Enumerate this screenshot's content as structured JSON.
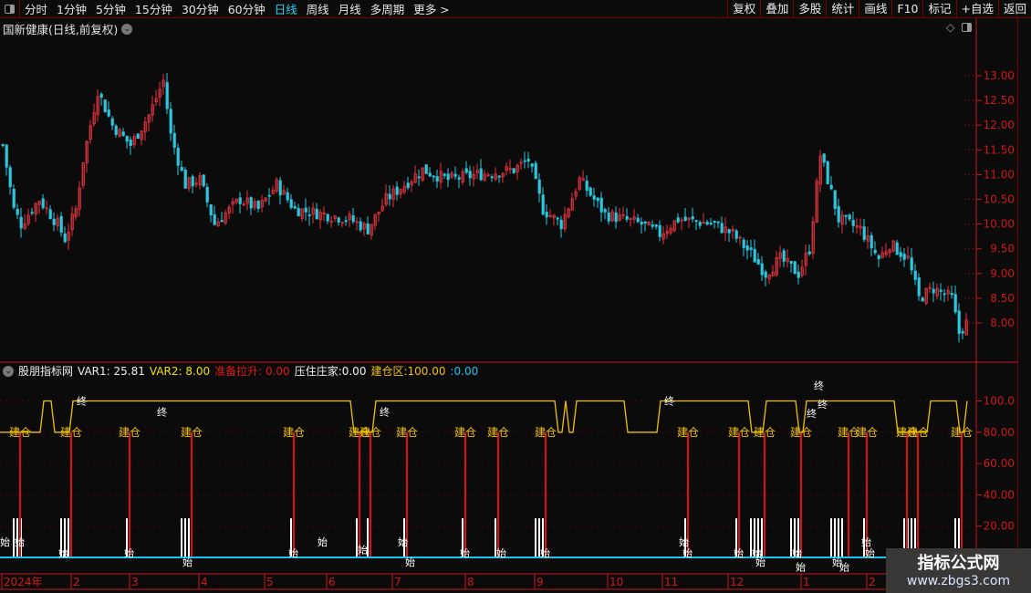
{
  "toolbar": {
    "periods": [
      "分时",
      "1分钟",
      "5分钟",
      "15分钟",
      "30分钟",
      "60分钟",
      "日线",
      "周线",
      "月线",
      "多周期",
      "更多 >"
    ],
    "active_period": "日线",
    "right_buttons": [
      "复权",
      "叠加",
      "多股",
      "统计",
      "画线",
      "F10",
      "标记",
      "+自选",
      "返回"
    ]
  },
  "main_chart": {
    "title": "国新健康(日线,前复权)",
    "y_ticks": [
      "13.00",
      "12.50",
      "12.00",
      "11.50",
      "11.00",
      "10.50",
      "10.00",
      "9.50",
      "9.00",
      "8.50",
      "8.00"
    ]
  },
  "indicator": {
    "name": "股朋指标网",
    "var1_label": "VAR1:",
    "var1": "25.81",
    "var2_label": "VAR2:",
    "var2": "8.00",
    "zbls_label": "准备拉升:",
    "zbls": "0.00",
    "yzzj_label": "压住庄家:",
    "yzzj": "0.00",
    "jcq_label": "建仓区:",
    "jcq": "100.00",
    "extra_label": ":",
    "extra": "0.00",
    "y_ticks": [
      "100.0",
      "80.00",
      "60.00",
      "40.00",
      "20.00"
    ],
    "label_build": "建仓",
    "label_end": "终",
    "label_start": "始"
  },
  "x_axis": {
    "labels": [
      "2024年",
      "2",
      "3",
      "4",
      "5",
      "6",
      "7",
      "8",
      "9",
      "10",
      "11",
      "12",
      "1",
      "2"
    ]
  },
  "watermark": {
    "line1": "指标公式网",
    "line2": "www.zbgs3.com"
  },
  "colors": {
    "up": "#e8323c",
    "down": "#29c8e0",
    "axis": "#c8141e",
    "yellow": "#f0c000",
    "cyan": "#19c6f0"
  },
  "chart_data": {
    "type": "candlestick",
    "y_range": [
      7.6,
      13.8
    ],
    "price_keypoints": [
      [
        0,
        11.6
      ],
      [
        3,
        10.3
      ],
      [
        5,
        10.0
      ],
      [
        10,
        10.5
      ],
      [
        15,
        10.0
      ],
      [
        17,
        9.7
      ],
      [
        20,
        10.3
      ],
      [
        22,
        11.3
      ],
      [
        26,
        12.7
      ],
      [
        30,
        12.0
      ],
      [
        35,
        11.6
      ],
      [
        40,
        12.2
      ],
      [
        44,
        12.9
      ],
      [
        46,
        11.8
      ],
      [
        50,
        10.8
      ],
      [
        54,
        10.9
      ],
      [
        58,
        10.0
      ],
      [
        65,
        10.5
      ],
      [
        70,
        10.3
      ],
      [
        75,
        10.8
      ],
      [
        80,
        10.3
      ],
      [
        88,
        10.2
      ],
      [
        95,
        10.1
      ],
      [
        100,
        9.9
      ],
      [
        105,
        10.5
      ],
      [
        115,
        11.1
      ],
      [
        122,
        10.9
      ],
      [
        130,
        11.0
      ],
      [
        140,
        11.1
      ],
      [
        144,
        11.3
      ],
      [
        148,
        10.3
      ],
      [
        153,
        10.0
      ],
      [
        158,
        10.9
      ],
      [
        165,
        10.2
      ],
      [
        175,
        10.0
      ],
      [
        180,
        9.8
      ],
      [
        185,
        10.1
      ],
      [
        195,
        10.0
      ],
      [
        200,
        9.8
      ],
      [
        205,
        9.4
      ],
      [
        209,
        9.0
      ],
      [
        213,
        9.3
      ],
      [
        218,
        9.0
      ],
      [
        221,
        9.5
      ],
      [
        224,
        11.4
      ],
      [
        226,
        10.9
      ],
      [
        229,
        10.1
      ],
      [
        235,
        9.9
      ],
      [
        240,
        9.3
      ],
      [
        243,
        9.6
      ],
      [
        248,
        9.3
      ],
      [
        251,
        8.5
      ],
      [
        255,
        8.7
      ],
      [
        260,
        8.5
      ],
      [
        262,
        7.8
      ],
      [
        264,
        8.0
      ]
    ],
    "indicator_series": {
      "jianc_segments": [
        [
          0,
          80
        ],
        [
          11,
          100
        ],
        [
          14,
          80
        ],
        [
          19,
          100
        ],
        [
          96,
          80
        ],
        [
          102,
          100
        ],
        [
          152,
          80
        ],
        [
          154,
          100
        ],
        [
          155,
          80
        ],
        [
          157,
          100
        ],
        [
          171,
          80
        ],
        [
          180,
          100
        ],
        [
          205,
          80
        ],
        [
          209,
          100
        ],
        [
          218,
          80
        ],
        [
          220,
          100
        ],
        [
          245,
          80
        ],
        [
          254,
          100
        ],
        [
          262,
          80
        ],
        [
          264,
          100
        ]
      ],
      "build_signals": [
        5,
        19,
        35,
        52,
        80,
        98,
        101,
        111,
        127,
        136,
        149,
        188,
        202,
        209,
        219,
        232,
        237,
        248,
        251,
        263
      ],
      "white_bars": [
        3,
        4,
        5,
        16,
        17,
        18,
        34,
        49,
        50,
        51,
        79,
        97,
        100,
        110,
        126,
        135,
        146,
        147,
        148,
        187,
        201,
        205,
        206,
        207,
        208,
        216,
        217,
        218,
        227,
        228,
        229,
        230,
        236,
        247,
        248,
        249,
        250,
        261,
        262
      ],
      "end_marks": [
        [
          22,
          100
        ],
        [
          44,
          93
        ],
        [
          105,
          93
        ],
        [
          183,
          100
        ],
        [
          224,
          110
        ],
        [
          225,
          98
        ],
        [
          222,
          92
        ]
      ],
      "start_marks": [
        [
          1,
          10
        ],
        [
          5,
          10
        ],
        [
          17,
          3
        ],
        [
          35,
          3
        ],
        [
          51,
          -3
        ],
        [
          80,
          3
        ],
        [
          88,
          10
        ],
        [
          99,
          5
        ],
        [
          110,
          10
        ],
        [
          112,
          -3
        ],
        [
          127,
          3
        ],
        [
          137,
          3
        ],
        [
          149,
          3
        ],
        [
          187,
          10
        ],
        [
          188,
          3
        ],
        [
          202,
          3
        ],
        [
          207,
          3
        ],
        [
          208,
          -3
        ],
        [
          218,
          3
        ],
        [
          219,
          -6
        ],
        [
          229,
          -3
        ],
        [
          237,
          10
        ],
        [
          238,
          3
        ],
        [
          231,
          -6
        ]
      ]
    },
    "x_labels_bars": [
      0,
      19,
      35,
      54,
      72,
      89,
      107,
      127,
      146,
      166,
      181,
      199,
      219,
      237
    ]
  }
}
